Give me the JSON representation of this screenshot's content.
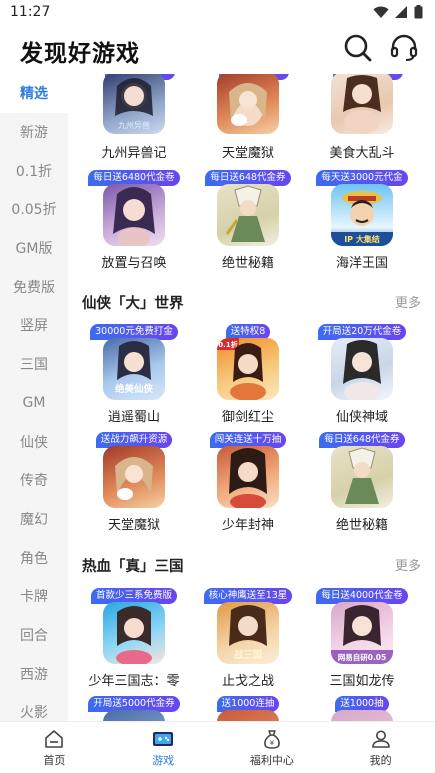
{
  "status": {
    "time": "11:27"
  },
  "header": {
    "title": "发现好游戏"
  },
  "sidebar": {
    "items": [
      {
        "label": "精选",
        "active": true
      },
      {
        "label": "新游"
      },
      {
        "label": "0.1折"
      },
      {
        "label": "0.05折"
      },
      {
        "label": "GM版"
      },
      {
        "label": "免费版"
      },
      {
        "label": "竖屏"
      },
      {
        "label": "三国"
      },
      {
        "label": "GM"
      },
      {
        "label": "仙侠"
      },
      {
        "label": "传奇"
      },
      {
        "label": "魔幻"
      },
      {
        "label": "角色"
      },
      {
        "label": "卡牌"
      },
      {
        "label": "回合"
      },
      {
        "label": "西游"
      },
      {
        "label": "火影"
      }
    ]
  },
  "top_games": {
    "row1": [
      {
        "name": "九州异兽记",
        "icon_text": "九州异兽"
      },
      {
        "name": "天堂魔狱",
        "icon_text": ""
      },
      {
        "name": "美食大乱斗",
        "icon_text": ""
      }
    ],
    "row2": [
      {
        "name": "放置与召唤",
        "badge": "每日送6480代金卷"
      },
      {
        "name": "绝世秘籍",
        "badge": "每日送648代金券"
      },
      {
        "name": "海洋王国",
        "badge": "每天送3000元代金",
        "icon_text": "IP 大集结"
      }
    ]
  },
  "sections": [
    {
      "title": "仙侠「大」世界",
      "more": "更多",
      "rows": [
        [
          {
            "name": "逍遥蜀山",
            "badge": "30000元免费打金",
            "icon_text": "绝美仙侠"
          },
          {
            "name": "御剑红尘",
            "badge": "送特权8",
            "icon_text": "0.1折"
          },
          {
            "name": "仙侠神域",
            "badge": "开局送20万代金卷"
          }
        ],
        [
          {
            "name": "天堂魔狱",
            "badge": "送战力飙升资源"
          },
          {
            "name": "少年封神",
            "badge": "闯关连送十万抽"
          },
          {
            "name": "绝世秘籍",
            "badge": "每日送648代金券"
          }
        ]
      ]
    },
    {
      "title": "热血「真」三国",
      "more": "更多",
      "rows": [
        [
          {
            "name": "少年三国志：零",
            "badge": "首款少三系免费版"
          },
          {
            "name": "止戈之战",
            "badge": "核心神鹰送至13星",
            "icon_text": "战三国"
          },
          {
            "name": "三国如龙传",
            "badge": "每日送4000代金卷",
            "icon_text": "网易自研0.05"
          }
        ],
        [
          {
            "name": "",
            "badge": "开局送5000代金券"
          },
          {
            "name": "",
            "badge": "送1000连抽"
          },
          {
            "name": "",
            "badge": "送1000抽"
          }
        ]
      ]
    }
  ],
  "bottom_nav": [
    {
      "label": "首页"
    },
    {
      "label": "游戏",
      "active": true
    },
    {
      "label": "福利中心"
    },
    {
      "label": "我的"
    }
  ],
  "colors": {
    "accent": "#2f7de1",
    "badge_start": "#3c6cf0",
    "badge_end": "#6a45f0",
    "sidebar_bg": "#f5f5f5"
  }
}
